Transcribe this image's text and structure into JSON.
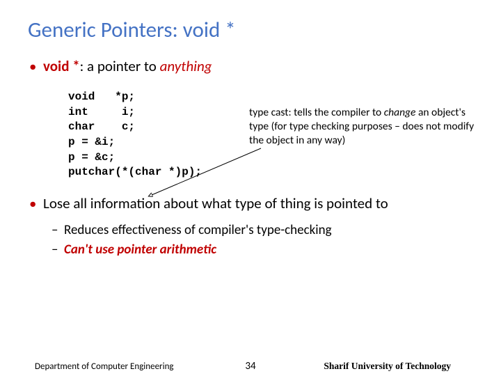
{
  "title": "Generic Pointers: void *",
  "bullets": {
    "b1_pre": "void *",
    "b1_mid": ": a pointer to ",
    "b1_post": "anything",
    "b2": "Lose all information about what type of thing is pointed to",
    "b2_1": "Reduces effectiveness of compiler's type-checking",
    "b2_2": "Can't use pointer arithmetic"
  },
  "code": "void   *p;\nint     i;\nchar    c;\np = &i;\np = &c;\nputchar(*(char *)p);",
  "annotation": {
    "pre": "type cast: tells the compiler to ",
    "change": "change",
    "post": " an object's type (for type checking purposes – does not modify the object in any way)"
  },
  "footer": {
    "left": "Department of Computer Engineering",
    "center": "34",
    "right": "Sharif University of Technology"
  }
}
